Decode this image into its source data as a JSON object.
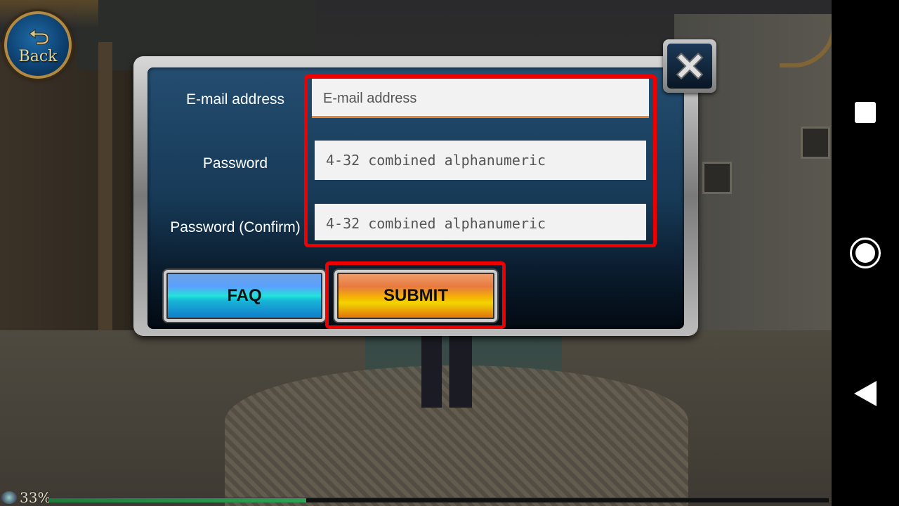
{
  "back_button": {
    "label": "Back"
  },
  "form": {
    "email": {
      "label": "E-mail address",
      "placeholder": "E-mail address"
    },
    "password": {
      "label": "Password",
      "placeholder": "4-32 combined alphanumeric"
    },
    "password_confirm": {
      "label": "Password (Confirm)",
      "placeholder": "4-32 combined alphanumeric"
    }
  },
  "buttons": {
    "faq": "FAQ",
    "submit": "SUBMIT"
  },
  "loading": {
    "percent_text": "33%",
    "progress_fraction": 0.33
  },
  "colors": {
    "highlight": "#ee0000",
    "email_focus_underline": "#e8882a"
  },
  "icons": {
    "back": "back-arrow-icon",
    "close": "close-x-icon",
    "nav_recents": "square-icon",
    "nav_home": "circle-icon",
    "nav_back": "triangle-back-icon"
  }
}
